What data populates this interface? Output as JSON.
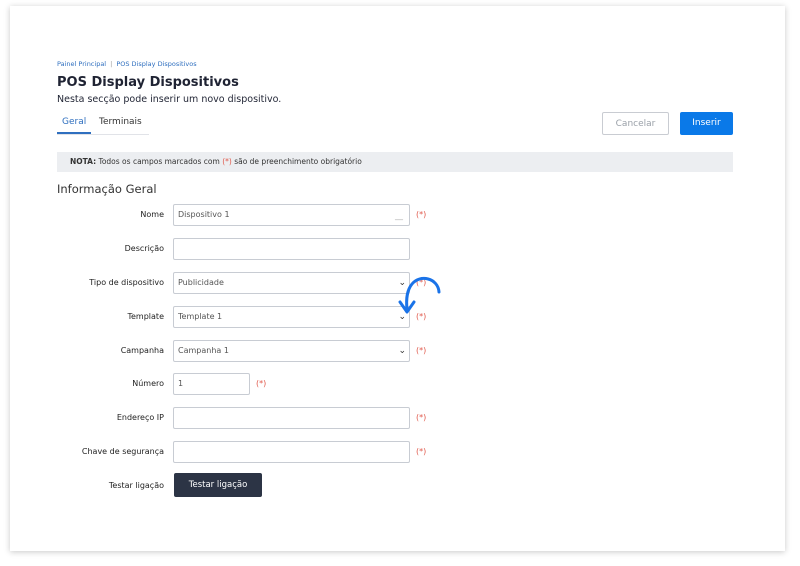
{
  "breadcrumb": {
    "home": "Painel Principal",
    "separator": "|",
    "current": "POS Display Dispositivos"
  },
  "page": {
    "title": "POS Display Dispositivos",
    "subtitle": "Nesta secção pode inserir um novo dispositivo."
  },
  "tabs": [
    {
      "label": "Geral",
      "active": true
    },
    {
      "label": "Terminais",
      "active": false
    }
  ],
  "actions": {
    "cancel": "Cancelar",
    "insert": "Inserir"
  },
  "note": {
    "prefix": "NOTA:",
    "text_before": " Todos os campos marcados com ",
    "marker": "(*)",
    "text_after": " são de preenchimento obrigatório"
  },
  "section_title": "Informação Geral",
  "form": {
    "nome": {
      "label": "Nome",
      "value": "Dispositivo 1",
      "required": "(*)"
    },
    "descricao": {
      "label": "Descrição",
      "value": ""
    },
    "tipo": {
      "label": "Tipo de dispositivo",
      "value": "Publicidade",
      "required": "(*)"
    },
    "template": {
      "label": "Template",
      "value": "Template 1",
      "required": "(*)"
    },
    "campanha": {
      "label": "Campanha",
      "value": "Campanha 1",
      "required": "(*)"
    },
    "numero": {
      "label": "Número",
      "value": "1",
      "required": "(*)"
    },
    "ip": {
      "label": "Endereço IP",
      "value": "",
      "required": "(*)"
    },
    "chave": {
      "label": "Chave de segurança",
      "value": "",
      "required": "(*)"
    },
    "testar": {
      "label": "Testar ligação",
      "button": "Testar ligação"
    }
  },
  "colors": {
    "accent": "#0a79e8",
    "link": "#2f6fbf",
    "required": "#e0584a",
    "dark_button": "#2c3445",
    "annotation_arrow": "#1a73e8"
  },
  "icons": {
    "select": "chevron-down-icon",
    "annotation": "curved-arrow-icon"
  }
}
